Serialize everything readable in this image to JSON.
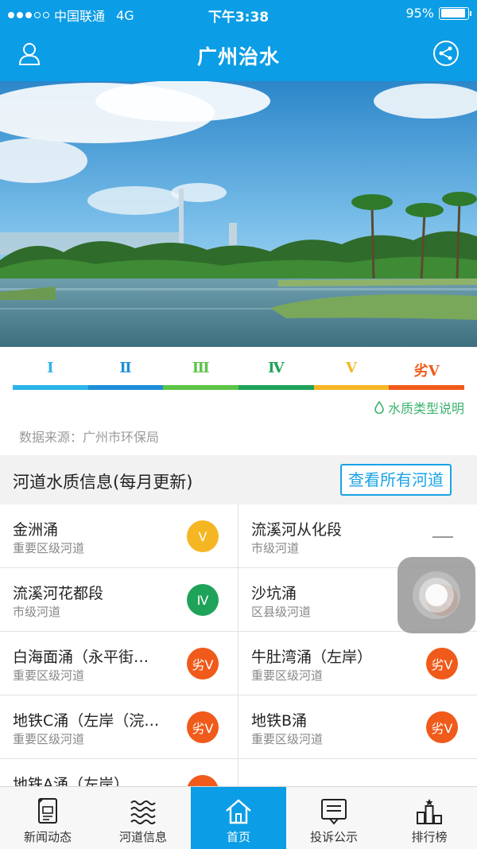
{
  "status_bar": {
    "carrier": "中国联通",
    "network": "4G",
    "time": "下午3:38",
    "battery": "95%"
  },
  "nav": {
    "title": "广州治水",
    "left_icon": "user-icon",
    "right_icon": "share-icon"
  },
  "scale": {
    "levels": [
      {
        "label": "Ⅰ",
        "color": "#2bb3ea"
      },
      {
        "label": "Ⅱ",
        "color": "#1d8fd8"
      },
      {
        "label": "Ⅲ",
        "color": "#5cc447"
      },
      {
        "label": "Ⅳ",
        "color": "#1fa35a"
      },
      {
        "label": "Ⅴ",
        "color": "#f5b623"
      },
      {
        "label": "劣Ⅴ",
        "color": "#f05a1a"
      }
    ],
    "legend_link": "水质类型说明",
    "source": "数据来源：广州市环保局"
  },
  "section": {
    "title": "河道水质信息(每月更新)",
    "view_all": "查看所有河道"
  },
  "rivers": [
    {
      "name": "金洲涌",
      "type": "重要区级河道",
      "grade": "Ⅴ",
      "color": "#f5b623"
    },
    {
      "name": "流溪河从化段",
      "type": "市级河道",
      "grade": "",
      "color": ""
    },
    {
      "name": "流溪河花都段",
      "type": "市级河道",
      "grade": "Ⅳ",
      "color": "#1fa35a"
    },
    {
      "name": "沙坑涌",
      "type": "区县级河道",
      "grade": "劣Ⅴ",
      "color": "#f05a1a"
    },
    {
      "name": "白海面涌（永平街…",
      "type": "重要区级河道",
      "grade": "劣Ⅴ",
      "color": "#f05a1a"
    },
    {
      "name": "牛肚湾涌（左岸）",
      "type": "重要区级河道",
      "grade": "劣Ⅴ",
      "color": "#f05a1a"
    },
    {
      "name": "地铁C涌（左岸（浣…",
      "type": "重要区级河道",
      "grade": "劣Ⅴ",
      "color": "#f05a1a"
    },
    {
      "name": "地铁B涌",
      "type": "重要区级河道",
      "grade": "劣Ⅴ",
      "color": "#f05a1a"
    },
    {
      "name": "地铁A涌（左岸）",
      "type": "",
      "grade": "劣Ⅴ",
      "color": "#f05a1a"
    },
    {
      "name": "",
      "type": "",
      "grade": "",
      "color": ""
    }
  ],
  "tabs": [
    {
      "label": "新闻动态",
      "icon": "news-icon",
      "active": false
    },
    {
      "label": "河道信息",
      "icon": "waves-icon",
      "active": false
    },
    {
      "label": "首页",
      "icon": "home-icon",
      "active": true
    },
    {
      "label": "投诉公示",
      "icon": "complaint-icon",
      "active": false
    },
    {
      "label": "排行榜",
      "icon": "ranking-icon",
      "active": false
    }
  ]
}
